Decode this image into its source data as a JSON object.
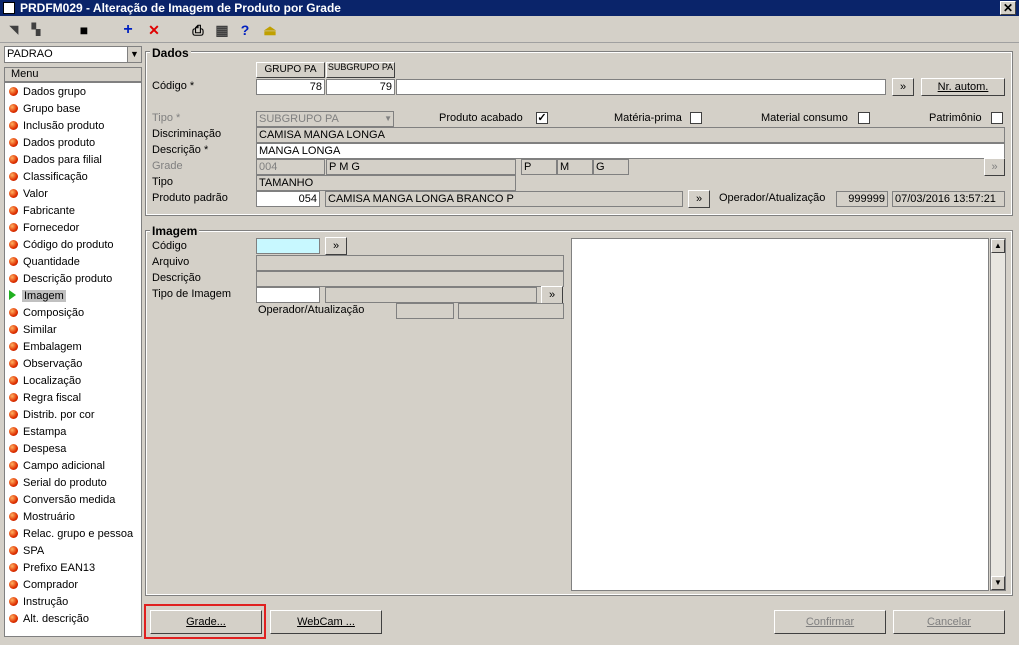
{
  "window": {
    "title": "PRDFM029 - Alteração de Imagem de Produto por Grade",
    "close": "✕"
  },
  "toolbar": {
    "btn_nav1": "◥",
    "btn_nav2": "▚",
    "btn_save": "■",
    "btn_add": "+",
    "btn_delete": "✕",
    "btn_print": "⎙",
    "btn_calc": "▦",
    "btn_help": "?",
    "btn_exit": "⏏"
  },
  "sidebar": {
    "combo_value": "PADRAO",
    "menu_header": "Menu",
    "items": [
      {
        "label": "Dados grupo"
      },
      {
        "label": "Grupo base"
      },
      {
        "label": "Inclusão produto"
      },
      {
        "label": "Dados produto"
      },
      {
        "label": "Dados para filial"
      },
      {
        "label": "Classificação"
      },
      {
        "label": "Valor"
      },
      {
        "label": "Fabricante"
      },
      {
        "label": "Fornecedor"
      },
      {
        "label": "Código do produto"
      },
      {
        "label": "Quantidade"
      },
      {
        "label": "Descrição produto"
      },
      {
        "label": "Imagem"
      },
      {
        "label": "Composição"
      },
      {
        "label": "Similar"
      },
      {
        "label": "Embalagem"
      },
      {
        "label": "Observação"
      },
      {
        "label": "Localização"
      },
      {
        "label": "Regra fiscal"
      },
      {
        "label": "Distrib. por cor"
      },
      {
        "label": "Estampa"
      },
      {
        "label": "Despesa"
      },
      {
        "label": "Campo adicional"
      },
      {
        "label": "Serial do produto"
      },
      {
        "label": "Conversão medida"
      },
      {
        "label": "Mostruário"
      },
      {
        "label": "Relac. grupo e pessoa"
      },
      {
        "label": "SPA"
      },
      {
        "label": "Prefixo EAN13"
      },
      {
        "label": "Comprador"
      },
      {
        "label": "Instrução"
      },
      {
        "label": "Alt. descrição"
      }
    ]
  },
  "dados": {
    "legend": "Dados",
    "col_grupo_pa": "GRUPO PA",
    "col_subgrupo_pa": "SUBGRUPO PA",
    "codigo_label": "Código *",
    "codigo_grupo": "78",
    "codigo_subgrupo": "79",
    "codigo_btn": "»",
    "nr_autom": "Nr. autom.",
    "tipo_label": "Tipo *",
    "tipo_value": "SUBGRUPO PA",
    "produto_acabado": "Produto acabado",
    "materia_prima": "Matéria-prima",
    "material_consumo": "Material consumo",
    "patrimonio": "Patrimônio",
    "check_mark": "✓",
    "discriminacao_label": "Discriminação",
    "discriminacao_value": "CAMISA MANGA LONGA",
    "descricao_label": "Descrição *",
    "descricao_value": "MANGA LONGA",
    "grade_label": "Grade",
    "grade_code": "004",
    "grade_desc": "P M G",
    "grade_sizes": [
      "P",
      "M",
      "G"
    ],
    "grade_btn": "»",
    "tipo2_label": "Tipo",
    "tipo2_value": "TAMANHO",
    "produto_padrao_label": "Produto padrão",
    "produto_padrao_code": "054",
    "produto_padrao_desc": "CAMISA MANGA LONGA BRANCO P",
    "produto_padrao_btn": "»",
    "operador_label": "Operador/Atualização",
    "operador_value": "999999",
    "atualizacao_value": "07/03/2016 13:57:21"
  },
  "imagem": {
    "legend": "Imagem",
    "codigo_label": "Código",
    "codigo_btn": "»",
    "arquivo_label": "Arquivo",
    "descricao_label": "Descrição",
    "tipo_label": "Tipo de Imagem",
    "tipo_btn": "»",
    "operador_label": "Operador/Atualização",
    "scroll_up": "▲",
    "scroll_down": "▼"
  },
  "footer": {
    "grade_btn": "Grade...",
    "webcam_btn": "WebCam ...",
    "confirmar_btn": "Confirmar",
    "cancelar_btn": "Cancelar"
  },
  "colors": {
    "titlebar": "#0a246a",
    "highlight_box": "#e02020",
    "codigo_input_bg": "#c8f8ff"
  }
}
